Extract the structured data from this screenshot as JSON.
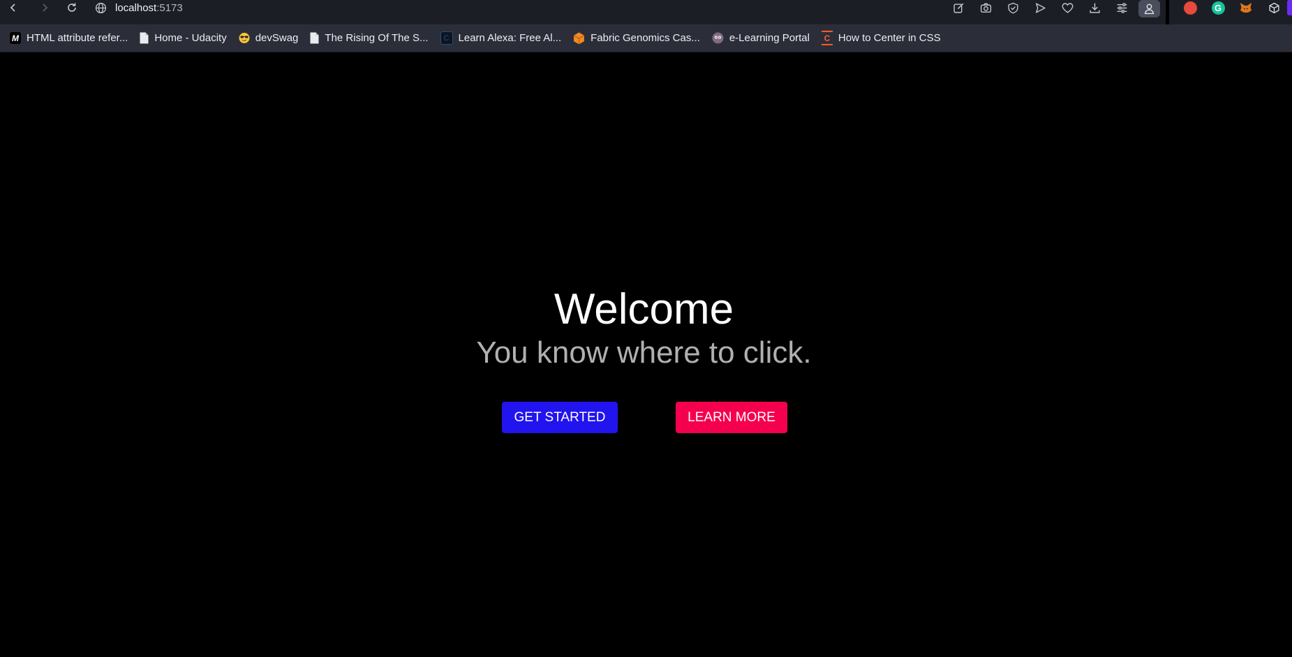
{
  "browser": {
    "url_host": "localhost",
    "url_port": ":5173",
    "toolbar_icons": [
      "edit-page-icon",
      "camera-icon",
      "shield-check-icon",
      "send-icon",
      "heart-icon",
      "download-icon",
      "sliders-icon",
      "profile-icon"
    ],
    "extensions": [
      {
        "name": "extension-red-icon",
        "color": "#e8493a"
      },
      {
        "name": "grammarly-icon",
        "color": "#15c39a"
      },
      {
        "name": "metamask-fox-icon",
        "color": "#e2761b"
      },
      {
        "name": "cube-extension-icon",
        "color": "#d8dae0"
      }
    ]
  },
  "bookmarks": [
    {
      "label": "HTML attribute refer...",
      "icon": "mdn-icon",
      "glyph": "M"
    },
    {
      "label": "Home - Udacity",
      "icon": "page-icon",
      "glyph": ""
    },
    {
      "label": "devSwag",
      "icon": "sunglasses-emoji-icon",
      "glyph": "😎"
    },
    {
      "label": "The Rising Of The S...",
      "icon": "page-icon",
      "glyph": ""
    },
    {
      "label": "Learn Alexa: Free Al...",
      "icon": "codecademy-icon",
      "glyph": "C"
    },
    {
      "label": "Fabric Genomics Cas...",
      "icon": "orange-cube-icon",
      "glyph": ""
    },
    {
      "label": "e-Learning Portal",
      "icon": "owl-icon",
      "glyph": "🦉"
    },
    {
      "label": "How to Center in CSS",
      "icon": "css-c-icon",
      "glyph": "C"
    }
  ],
  "hero": {
    "title": "Welcome",
    "subtitle": "You know where to click."
  },
  "buttons": {
    "primary_label": "GET STARTED",
    "primary_color": "#2214ee",
    "secondary_label": "LEARN MORE",
    "secondary_color": "#f4004e"
  }
}
